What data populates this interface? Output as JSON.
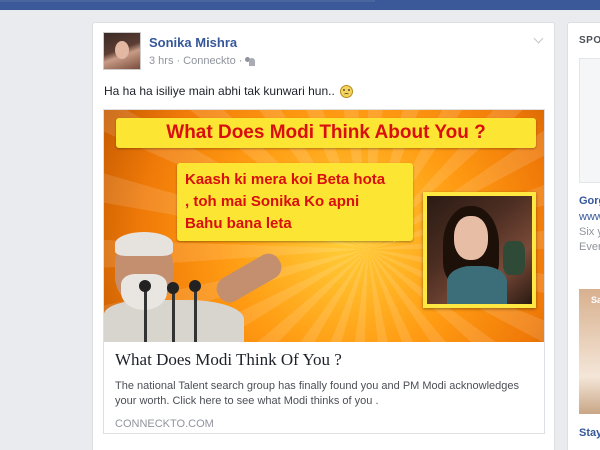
{
  "post": {
    "author": "Sonika Mishra",
    "time": "3 hrs",
    "separator": "·",
    "via": "Conneckto",
    "audience_icon": "friends-icon",
    "status": "Ha ha ha isiliye main abhi tak kunwari hun..",
    "status_emoji": "smiley-icon"
  },
  "card": {
    "banner": "What Does Modi Think About You ?",
    "quote_line1": "Kaash ki mera koi Beta hota",
    "quote_line2": ", toh mai Sonika Ko apni",
    "quote_line3": "Bahu bana leta",
    "title": "What Does Modi Think Of You ?",
    "description": "The national Talent search group has finally found you and PM Modi acknowledges your worth. Click here to see what Modi thinks of you .",
    "domain": "CONNECKTO.COM"
  },
  "sidebar": {
    "heading": "SPO",
    "ad1_title": "Gorg",
    "ad1_line1": "www",
    "ad1_line2": "Six y",
    "ad1_line3": "Ever",
    "ad2_image_text": "Say",
    "ad2_title": "Stay"
  },
  "colors": {
    "topbar": "#3b5998",
    "link": "#365899",
    "banner_bg": "#fde533",
    "banner_text": "#d90f0f"
  }
}
